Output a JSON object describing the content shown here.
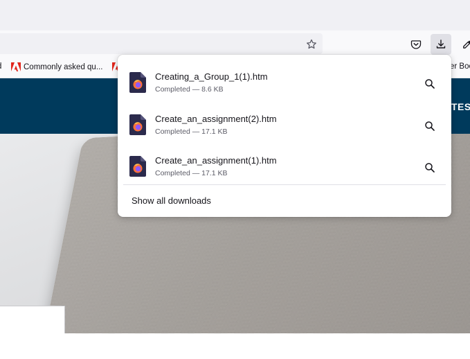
{
  "toolbar": {
    "bookmark_star_icon": "star-icon",
    "pocket_icon": "pocket-icon",
    "downloads_icon": "downloads-icon",
    "eyedropper_icon": "eyedropper-icon"
  },
  "bookmarks": {
    "cut_left_label": "d",
    "items": [
      {
        "label": "Commonly asked qu...",
        "icon": "adobe-icon"
      },
      {
        "label": "",
        "icon": "adobe-icon"
      }
    ],
    "cut_right_label": "er Boo"
  },
  "page": {
    "hero_text": "TES",
    "colors": {
      "hero_band": "#003a5c"
    }
  },
  "downloads": {
    "items": [
      {
        "filename": "Creating_a_Group_1(1).htm",
        "status": "Completed — 8.6 KB",
        "icon": "firefox-file-icon"
      },
      {
        "filename": "Create_an_assignment(2).htm",
        "status": "Completed — 17.1 KB",
        "icon": "firefox-file-icon"
      },
      {
        "filename": "Create_an_assignment(1).htm",
        "status": "Completed — 17.1 KB",
        "icon": "firefox-file-icon"
      }
    ],
    "show_all_label": "Show all downloads"
  }
}
